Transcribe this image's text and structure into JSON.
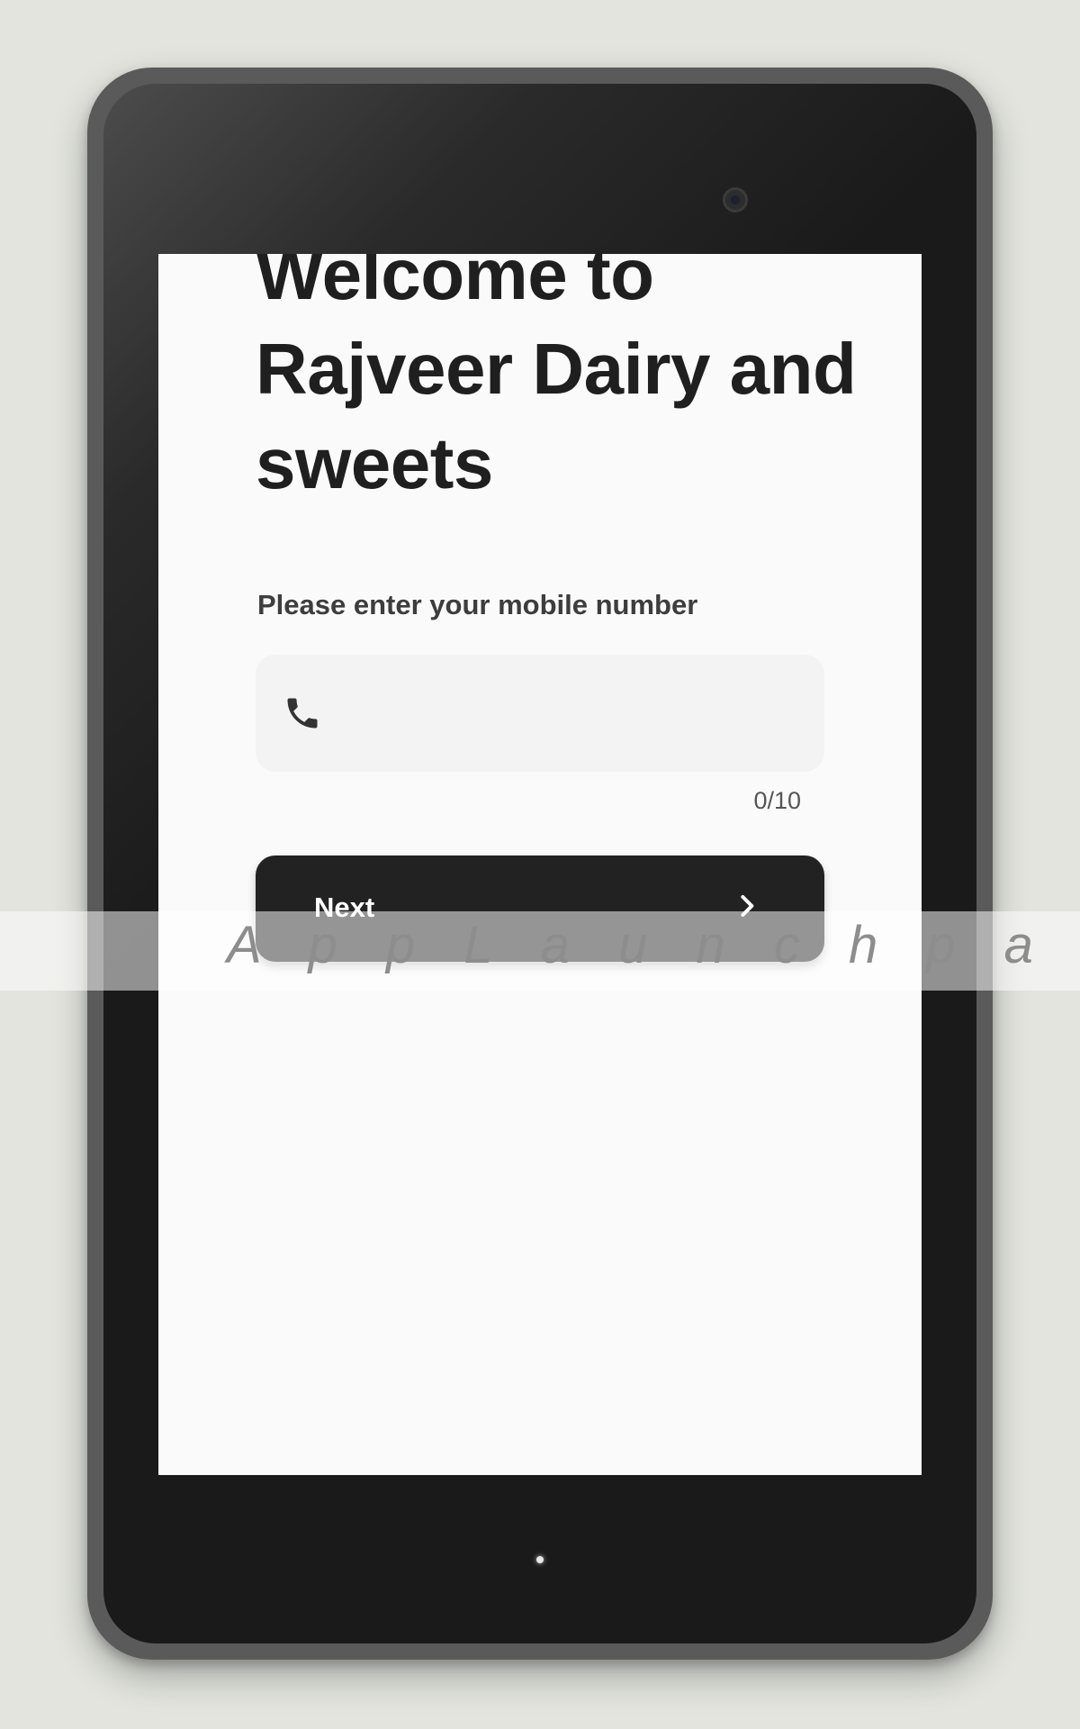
{
  "screen": {
    "title": "Welcome to Rajveer Dairy and sweets",
    "prompt": "Please enter your mobile number",
    "phone_field": {
      "value": "",
      "placeholder": "",
      "icon": "phone-icon"
    },
    "counter": "0/10",
    "next_button": {
      "label": "Next",
      "icon": "chevron-right-icon"
    }
  },
  "watermark": {
    "text": "A p p L a u n c h p a d"
  },
  "colors": {
    "background": "#e2e4dd",
    "screen": "#fafafa",
    "button": "#222222",
    "field": "#f3f3f3",
    "text": "#1f1f1f"
  }
}
